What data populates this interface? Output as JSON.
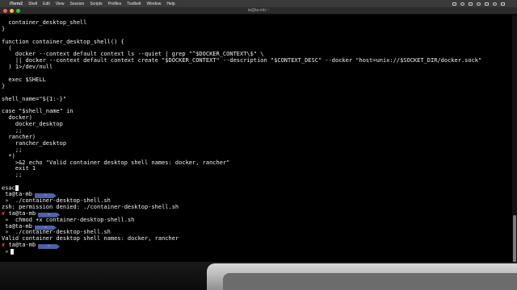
{
  "menubar": {
    "app": "iTerm2",
    "items": [
      "Shell",
      "Edit",
      "View",
      "Session",
      "Scripts",
      "Profiles",
      "Toolbelt",
      "Window",
      "Help"
    ],
    "clock": ""
  },
  "window": {
    "title": "ta@ta-mb:~"
  },
  "prompt": {
    "user": "ta@ta-mb",
    "badge": "~"
  },
  "terminal": {
    "lines": [
      "  container_desktop_shell",
      "}",
      "",
      "function container_desktop_shell() {",
      "  (",
      "    docker --context default context ls --quiet | grep \"^$DOCKER_CONTEXT\\$\" \\",
      "    || docker --context default context create \"$DOCKER_CONTEXT\" --description \"$CONTEXT_DESC\" --docker \"host=unix://$SOCKET_DIR/docker.sock\"",
      "  ) 1>/dev/null",
      "",
      "  exec $SHELL",
      "}",
      "",
      "shell_name=\"${1:-}\"",
      "",
      "case \"$shell_name\" in",
      "  docker)",
      "    docker_desktop",
      "    ;;",
      "  rancher)",
      "    rancher_desktop",
      "    ;;",
      "  *)",
      "    >&2 echo \"Valid container desktop shell names: docker, rancher\"",
      "    exit 1",
      "    ;;",
      "",
      "esac"
    ],
    "session": [
      {
        "kind": "prompt",
        "x": false
      },
      {
        "kind": "cmd",
        "text": "./container-desktop-shell.sh"
      },
      {
        "kind": "out",
        "text": "zsh: permission denied: ./container-desktop-shell.sh"
      },
      {
        "kind": "prompt",
        "x": true
      },
      {
        "kind": "cmd",
        "text": "chmod +x container-desktop-shell.sh"
      },
      {
        "kind": "prompt",
        "x": false
      },
      {
        "kind": "cmd",
        "text": "./container-desktop-shell.sh"
      },
      {
        "kind": "out",
        "text": "Valid container desktop shell names: docker, rancher"
      },
      {
        "kind": "prompt",
        "x": true
      },
      {
        "kind": "current"
      }
    ]
  },
  "glyphs": {
    "x": "✘",
    "arrow": "»"
  },
  "colors": {
    "badge": "#4d62a8",
    "error_x": "#e0443e",
    "text": "#f2f2f2"
  }
}
